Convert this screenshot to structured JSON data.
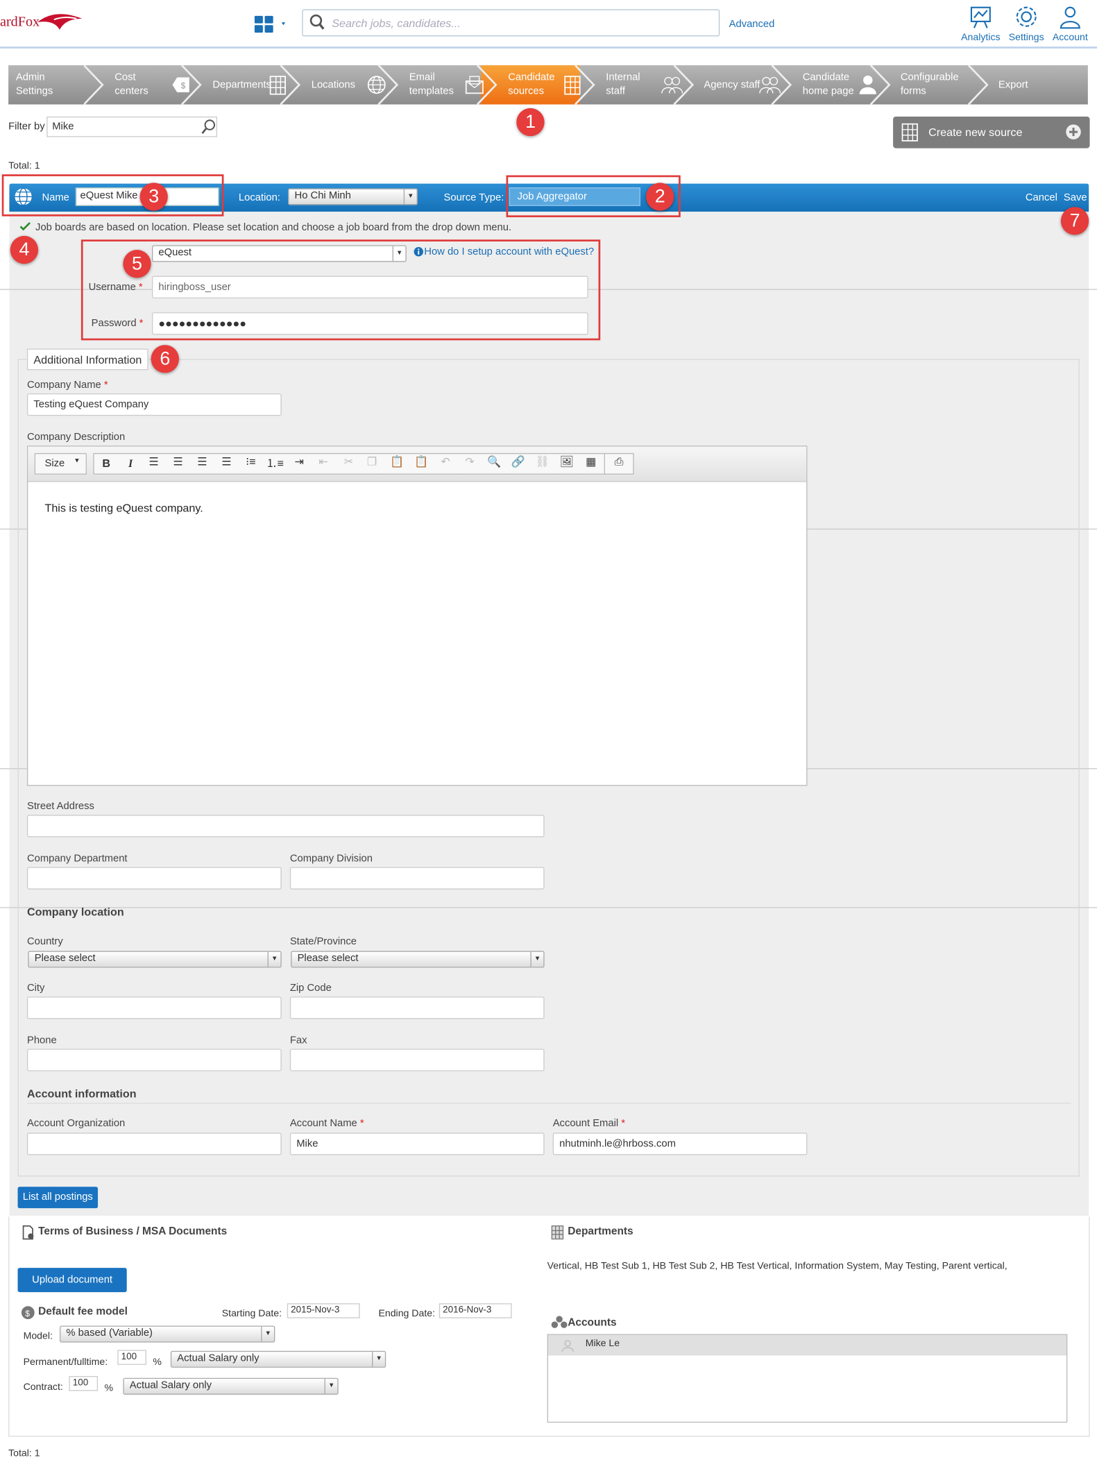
{
  "brand": {
    "name": "ardFox"
  },
  "search": {
    "placeholder": "Search jobs, candidates...",
    "advanced": "Advanced"
  },
  "top_icons": [
    {
      "label": "Analytics",
      "icon": "analytics-icon"
    },
    {
      "label": "Settings",
      "icon": "gear-icon"
    },
    {
      "label": "Account",
      "icon": "user-icon"
    }
  ],
  "nav": [
    {
      "line1": "Admin",
      "line2": "Settings"
    },
    {
      "line1": "Cost",
      "line2": "centers"
    },
    {
      "line1": "Departments",
      "line2": ""
    },
    {
      "line1": "Locations",
      "line2": ""
    },
    {
      "line1": "Email",
      "line2": "templates"
    },
    {
      "line1": "Candidate",
      "line2": "sources"
    },
    {
      "line1": "Internal",
      "line2": "staff"
    },
    {
      "line1": "Agency staff",
      "line2": ""
    },
    {
      "line1": "Candidate",
      "line2": "home page"
    },
    {
      "line1": "Configurable",
      "line2": "forms"
    },
    {
      "line1": "Export",
      "line2": ""
    }
  ],
  "filter": {
    "label": "Filter by",
    "value": "Mike"
  },
  "create_button": "Create new source",
  "total_top": "Total: 1",
  "total_bottom": "Total: 1",
  "header": {
    "name_label": "Name",
    "name_value": "eQuest Mike",
    "location_label": "Location:",
    "location_value": "Ho Chi Minh",
    "source_type_label": "Source Type:",
    "source_type_value": "Job Aggregator",
    "cancel": "Cancel",
    "save": "Save"
  },
  "notice": "Job boards are based on location. Please set location and choose a job board from the drop down menu.",
  "job_board": {
    "value": "eQuest",
    "help": "How do I setup account with eQuest?",
    "username_label": "Username",
    "username_value": "hiringboss_user",
    "password_label": "Password",
    "password_value": "●●●●●●●●●●●●●"
  },
  "badges": [
    "1",
    "2",
    "3",
    "4",
    "5",
    "6",
    "7"
  ],
  "additional": {
    "legend": "Additional Information",
    "company_name_label": "Company Name",
    "company_name_value": "Testing eQuest Company",
    "company_desc_label": "Company Description",
    "editor_size": "Size",
    "editor_text": "This is testing eQuest company.",
    "street_label": "Street Address",
    "dept_label": "Company Department",
    "division_label": "Company Division",
    "location_title": "Company location",
    "country_label": "Country",
    "country_value": "Please select",
    "state_label": "State/Province",
    "state_value": "Please select",
    "city_label": "City",
    "zip_label": "Zip Code",
    "phone_label": "Phone",
    "fax_label": "Fax",
    "account_title": "Account information",
    "acct_org_label": "Account Organization",
    "acct_name_label": "Account Name",
    "acct_name_value": "Mike",
    "acct_email_label": "Account Email",
    "acct_email_value": "nhutminh.le@hrboss.com"
  },
  "list_postings": "List all postings",
  "terms_title": "Terms of Business / MSA Documents",
  "upload_button": "Upload document",
  "fee": {
    "title": "Default fee model",
    "start_label": "Starting Date:",
    "start_value": "2015-Nov-3",
    "end_label": "Ending Date:",
    "end_value": "2016-Nov-3",
    "model_label": "Model:",
    "model_value": "% based (Variable)",
    "perm_label": "Permanent/fulltime:",
    "perm_value": "100",
    "perm_basis": "Actual Salary only",
    "contract_label": "Contract:",
    "contract_value": "100",
    "contract_basis": "Actual Salary only",
    "pct": "%"
  },
  "departments": {
    "title": "Departments",
    "text": "Vertical, HB Test Sub 1, HB Test Sub 2, HB Test Vertical, Information System, May Testing, Parent vertical,"
  },
  "accounts": {
    "title": "Accounts",
    "items": [
      "Mike Le"
    ]
  },
  "colors": {
    "accent": "#1a73c0",
    "active_tab": "#f07d1a",
    "annotation": "#e63c3c"
  }
}
